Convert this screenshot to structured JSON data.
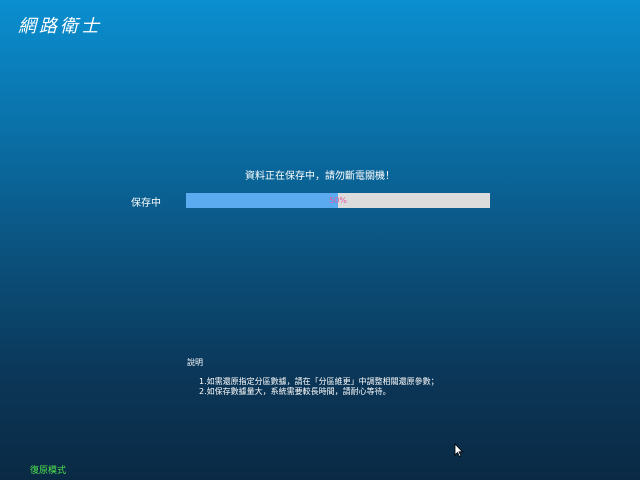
{
  "app": {
    "title": "網路衛士"
  },
  "status": {
    "message": "資料正在保存中，請勿斷電關機！",
    "label": "保存中",
    "progress_percent": 50,
    "progress_text": "50%",
    "fill_color": "#5aabf0",
    "track_color": "#dcdcdc"
  },
  "notes": {
    "title": "說明",
    "items": [
      "1.如需還原指定分區數據，請在「分區維更」中調整相關還原參數；",
      "2.如保存數據量大，系統需要較長時間，請耐心等待。"
    ]
  },
  "footer": {
    "restore_mode": "復原模式"
  },
  "icons": {
    "cursor": "mouse-pointer-icon"
  }
}
